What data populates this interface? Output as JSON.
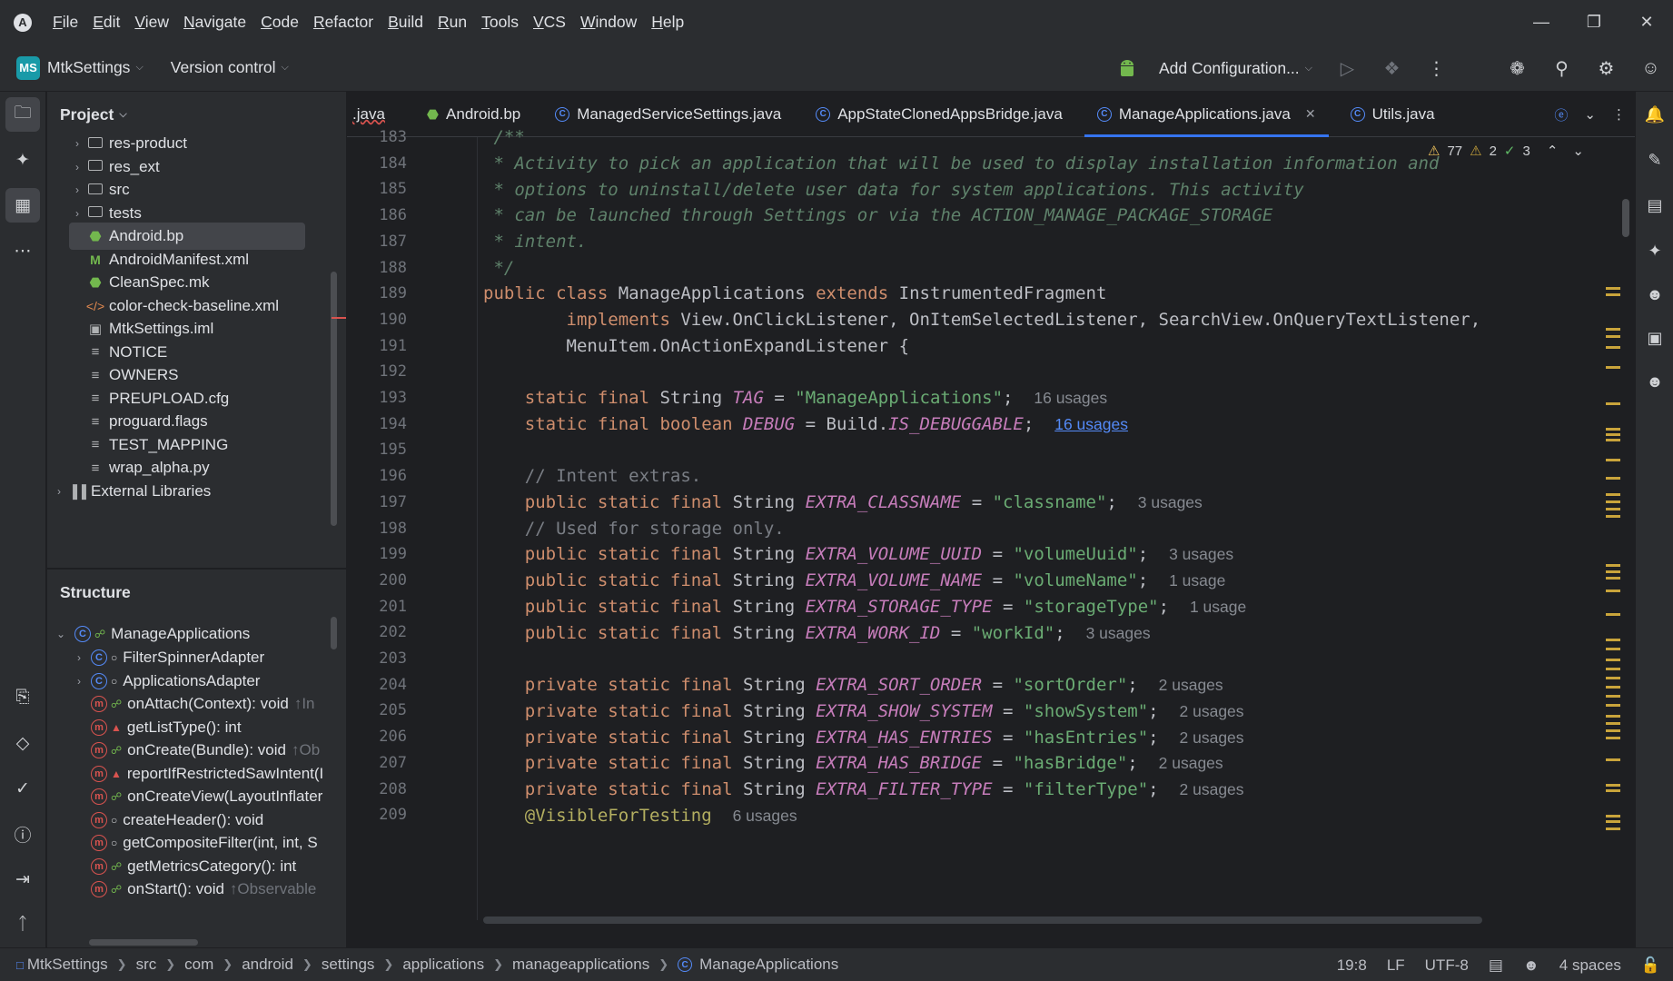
{
  "menubar": {
    "items": [
      {
        "mn": "F",
        "rest": "ile"
      },
      {
        "mn": "E",
        "rest": "dit"
      },
      {
        "mn": "V",
        "rest": "iew"
      },
      {
        "mn": "N",
        "rest": "avigate"
      },
      {
        "mn": "C",
        "rest": "ode"
      },
      {
        "mn": "R",
        "rest": "efactor"
      },
      {
        "mn": "B",
        "rest": "uild"
      },
      {
        "mn": "R",
        "rest": "un"
      },
      {
        "mn": "T",
        "rest": "ools"
      },
      {
        "mn": "V",
        "rest": "CS"
      },
      {
        "mn": "W",
        "rest": "indow"
      },
      {
        "mn": "H",
        "rest": "elp"
      }
    ]
  },
  "toolbar": {
    "project_badge": "MS",
    "project_name": "MtkSettings",
    "vcs_label": "Version control",
    "config_label": "Add Configuration..."
  },
  "project_panel": {
    "title": "Project",
    "items": [
      {
        "label": "res-product",
        "icon": "folder",
        "arrow": "›"
      },
      {
        "label": "res_ext",
        "icon": "folder",
        "arrow": "›"
      },
      {
        "label": "src",
        "icon": "folder",
        "arrow": "›"
      },
      {
        "label": "tests",
        "icon": "folder",
        "arrow": "›"
      },
      {
        "label": "Android.bp",
        "icon": "android"
      },
      {
        "label": "AndroidManifest.xml",
        "icon": "manifest"
      },
      {
        "label": "CleanSpec.mk",
        "icon": "android"
      },
      {
        "label": "color-check-baseline.xml",
        "icon": "code"
      },
      {
        "label": "MtkSettings.iml",
        "icon": "iml"
      },
      {
        "label": "NOTICE",
        "icon": "text"
      },
      {
        "label": "OWNERS",
        "icon": "text"
      },
      {
        "label": "PREUPLOAD.cfg",
        "icon": "text"
      },
      {
        "label": "proguard.flags",
        "icon": "text"
      },
      {
        "label": "TEST_MAPPING",
        "icon": "text"
      },
      {
        "label": "wrap_alpha.py",
        "icon": "text"
      },
      {
        "label": "External Libraries",
        "icon": "library",
        "arrow": "›"
      }
    ],
    "selected": "Android.bp"
  },
  "structure_panel": {
    "title": "Structure",
    "root": "ManageApplications",
    "items": [
      {
        "label": "FilterSpinnerAdapter",
        "kind": "class",
        "vis": "circle",
        "hint": ""
      },
      {
        "label": "ApplicationsAdapter",
        "kind": "class",
        "vis": "circle",
        "hint": ""
      },
      {
        "label": "onAttach(Context): void",
        "kind": "method",
        "vis": "public",
        "hint": "↑In"
      },
      {
        "label": "getListType(): int",
        "kind": "method",
        "vis": "lock",
        "hint": ""
      },
      {
        "label": "onCreate(Bundle): void",
        "kind": "method",
        "vis": "public",
        "hint": "↑Ob"
      },
      {
        "label": "reportIfRestrictedSawIntent(I",
        "kind": "method",
        "vis": "lock",
        "hint": ""
      },
      {
        "label": "onCreateView(LayoutInflater",
        "kind": "method",
        "vis": "public",
        "hint": ""
      },
      {
        "label": "createHeader(): void",
        "kind": "method",
        "vis": "circle",
        "hint": ""
      },
      {
        "label": "getCompositeFilter(int, int, S",
        "kind": "method",
        "vis": "circle",
        "hint": ""
      },
      {
        "label": "getMetricsCategory(): int",
        "kind": "method",
        "vis": "public",
        "hint": ""
      },
      {
        "label": "onStart(): void",
        "kind": "method",
        "vis": "public",
        "hint": "↑Observable"
      }
    ]
  },
  "tabs": [
    {
      "label": ".java",
      "icon": "none"
    },
    {
      "label": "Android.bp",
      "icon": "android"
    },
    {
      "label": "ManagedServiceSettings.java",
      "icon": "class"
    },
    {
      "label": "AppStateClonedAppsBridge.java",
      "icon": "class"
    },
    {
      "label": "ManageApplications.java",
      "icon": "class",
      "active": true
    },
    {
      "label": "Utils.java",
      "icon": "class"
    }
  ],
  "inspections": {
    "warnings": "77",
    "weak_warnings": "2",
    "ok": "3"
  },
  "line_numbers": [
    "183",
    "184",
    "185",
    "186",
    "187",
    "188",
    "189",
    "190",
    "191",
    "192",
    "193",
    "194",
    "195",
    "196",
    "197",
    "198",
    "199",
    "200",
    "201",
    "202",
    "203",
    "204",
    "205",
    "206",
    "207",
    "208",
    "209"
  ],
  "code": {
    "l184": " * Activity to pick an application that will be used to display installation information and",
    "l185": " * options to uninstall/delete user data for system applications. This activity",
    "l186": " * can be launched through Settings or via the ACTION_MANAGE_PACKAGE_STORAGE",
    "l187": " * intent.",
    "l188": " */",
    "l189_kw1": "public class",
    "l189_name": "ManageApplications",
    "l189_kw2": "extends",
    "l189_base": "InstrumentedFragment",
    "l190_kw": "implements",
    "l190_rest": "View.OnClickListener, OnItemSelectedListener, SearchView.OnQueryTextListener,",
    "l191": "MenuItem.OnActionExpandListener {",
    "l193_kw": "static final",
    "l193_type": "String",
    "l193_field": "TAG",
    "l193_eq": " = ",
    "l193_val": "\"ManageApplications\"",
    "l193_end": ";",
    "l193_usages": "16 usages",
    "l194_kw": "static final boolean",
    "l194_field": "DEBUG",
    "l194_eq": " = Build.",
    "l194_val": "IS_DEBUGGABLE",
    "l194_end": ";",
    "l194_usages": "16 usages",
    "l196": "// Intent extras.",
    "l197_field": "EXTRA_CLASSNAME",
    "l197_val": "\"classname\"",
    "l197_usages": "3 usages",
    "l198": "// Used for storage only.",
    "l199_field": "EXTRA_VOLUME_UUID",
    "l199_val": "\"volumeUuid\"",
    "l199_usages": "3 usages",
    "l200_field": "EXTRA_VOLUME_NAME",
    "l200_val": "\"volumeName\"",
    "l200_usages": "1 usage",
    "l201_field": "EXTRA_STORAGE_TYPE",
    "l201_val": "\"storageType\"",
    "l201_usages": "1 usage",
    "l202_field": "EXTRA_WORK_ID",
    "l202_val": "\"workId\"",
    "l202_usages": "3 usages",
    "l204_field": "EXTRA_SORT_ORDER",
    "l204_val": "\"sortOrder\"",
    "l204_usages": "2 usages",
    "l205_field": "EXTRA_SHOW_SYSTEM",
    "l205_val": "\"showSystem\"",
    "l205_usages": "2 usages",
    "l206_field": "EXTRA_HAS_ENTRIES",
    "l206_val": "\"hasEntries\"",
    "l206_usages": "2 usages",
    "l207_field": "EXTRA_HAS_BRIDGE",
    "l207_val": "\"hasBridge\"",
    "l207_usages": "2 usages",
    "l208_field": "EXTRA_FILTER_TYPE",
    "l208_val": "\"filterType\"",
    "l208_usages": "2 usages",
    "l209_ann": "@VisibleForTesting",
    "l209_usages": "6 usages",
    "psf": "public static final",
    "prsf": "private static final",
    "type_string": "String",
    "eq": " = ",
    "semi": ";"
  },
  "breadcrumb": [
    "MtkSettings",
    "src",
    "com",
    "android",
    "settings",
    "applications",
    "manageapplications",
    "ManageApplications"
  ],
  "status": {
    "position": "19:8",
    "line_sep": "LF",
    "encoding": "UTF-8",
    "indent": "4 spaces"
  },
  "colors": {
    "accent": "#3574f0",
    "bg": "#1e1f22",
    "panel": "#2b2d30"
  }
}
